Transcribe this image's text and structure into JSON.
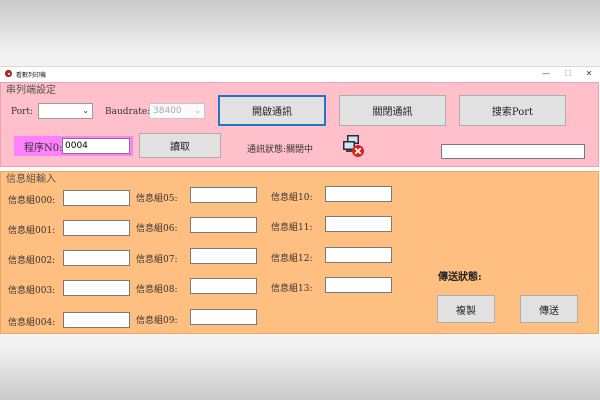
{
  "window": {
    "title": "看數列印機",
    "min_glyph": "—",
    "max_glyph": "☐",
    "close_glyph": "✕"
  },
  "serial": {
    "group_title": "串列端設定",
    "port_label": "Port:",
    "port_value": "",
    "baud_label": "Baudrate:",
    "baud_value": "38400",
    "open_button": "開啟通訊",
    "close_button": "關閉通訊",
    "search_button": "搜索Port",
    "program_label": "程序N0:",
    "program_value": "0004",
    "read_button": "讀取",
    "status_text": "通訊狀態:關閉中",
    "status_icon": "network-disconnected-icon",
    "message_value": ""
  },
  "messages": {
    "group_title": "信息組輸入",
    "fields": [
      {
        "label": "信息組000:",
        "value": ""
      },
      {
        "label": "信息組001:",
        "value": ""
      },
      {
        "label": "信息組002:",
        "value": ""
      },
      {
        "label": "信息組003:",
        "value": ""
      },
      {
        "label": "信息組004:",
        "value": ""
      },
      {
        "label": "信息組05:",
        "value": ""
      },
      {
        "label": "信息組06:",
        "value": ""
      },
      {
        "label": "信息組07:",
        "value": ""
      },
      {
        "label": "信息組08:",
        "value": ""
      },
      {
        "label": "信息組09:",
        "value": ""
      },
      {
        "label": "信息組10:",
        "value": ""
      },
      {
        "label": "信息組11:",
        "value": ""
      },
      {
        "label": "信息組12:",
        "value": ""
      },
      {
        "label": "信息組13:",
        "value": ""
      }
    ],
    "send_status_label": "傳送狀態:",
    "copy_button": "複製",
    "send_button": "傳送"
  }
}
